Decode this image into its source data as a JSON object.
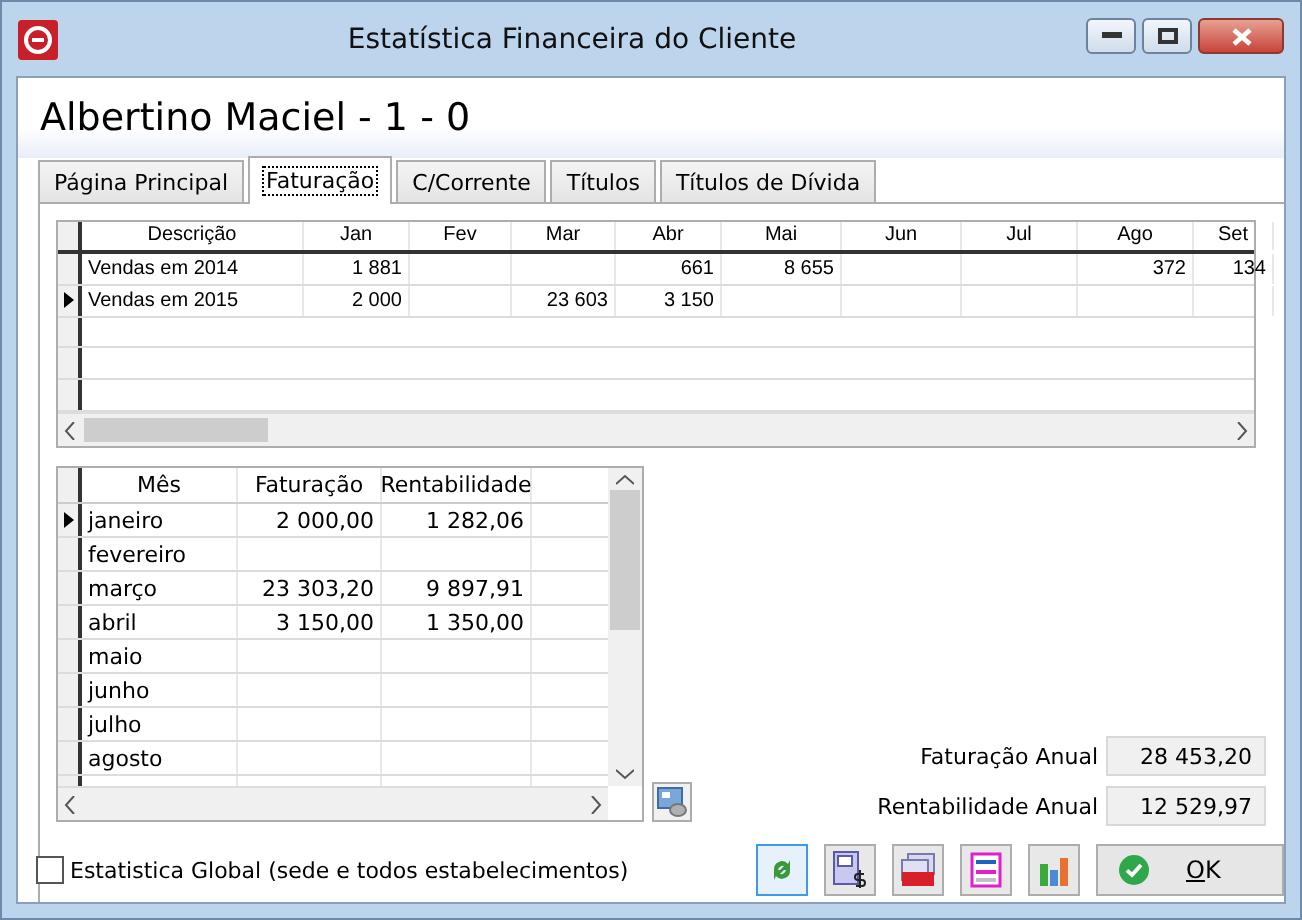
{
  "window": {
    "title": "Estatística Financeira do Cliente"
  },
  "client_name": "Albertino Maciel - 1 - 0",
  "tabs": [
    {
      "label": "Página Principal",
      "selected": false
    },
    {
      "label": "Faturação",
      "selected": true
    },
    {
      "label": "C/Corrente",
      "selected": false
    },
    {
      "label": "Títulos",
      "selected": false
    },
    {
      "label": "Títulos de Dívida",
      "selected": false
    }
  ],
  "yearly_table": {
    "columns": [
      "Descrição",
      "Jan",
      "Fev",
      "Mar",
      "Abr",
      "Mai",
      "Jun",
      "Jul",
      "Ago",
      "Set"
    ],
    "rows": [
      {
        "selected": false,
        "cells": [
          "Vendas em 2014",
          "1 881",
          null,
          null,
          "661",
          "8 655",
          null,
          null,
          "372",
          "134"
        ]
      },
      {
        "selected": true,
        "cells": [
          "Vendas em 2015",
          "2 000",
          null,
          "23 603",
          "3 150",
          null,
          null,
          null,
          null,
          null
        ]
      }
    ]
  },
  "monthly_table": {
    "columns": [
      "Mês",
      "Faturação",
      "Rentabilidade"
    ],
    "rows": [
      {
        "selected": true,
        "cells": [
          "janeiro",
          "2 000,00",
          "1 282,06"
        ]
      },
      {
        "selected": false,
        "cells": [
          "fevereiro",
          null,
          null
        ]
      },
      {
        "selected": false,
        "cells": [
          "março",
          "23 303,20",
          "9 897,91"
        ]
      },
      {
        "selected": false,
        "cells": [
          "abril",
          "3 150,00",
          "1 350,00"
        ]
      },
      {
        "selected": false,
        "cells": [
          "maio",
          null,
          null
        ]
      },
      {
        "selected": false,
        "cells": [
          "junho",
          null,
          null
        ]
      },
      {
        "selected": false,
        "cells": [
          "julho",
          null,
          null
        ]
      },
      {
        "selected": false,
        "cells": [
          "agosto",
          null,
          null
        ]
      }
    ]
  },
  "totals": [
    {
      "label": "Faturação Anual",
      "value": "28 453,20"
    },
    {
      "label": "Rentabilidade Anual",
      "value": "12 529,97"
    }
  ],
  "global_checkbox": {
    "label": "Estatistica Global (sede e todos estabelecimentos)",
    "checked": false
  },
  "ok_button": {
    "label": "OK"
  }
}
